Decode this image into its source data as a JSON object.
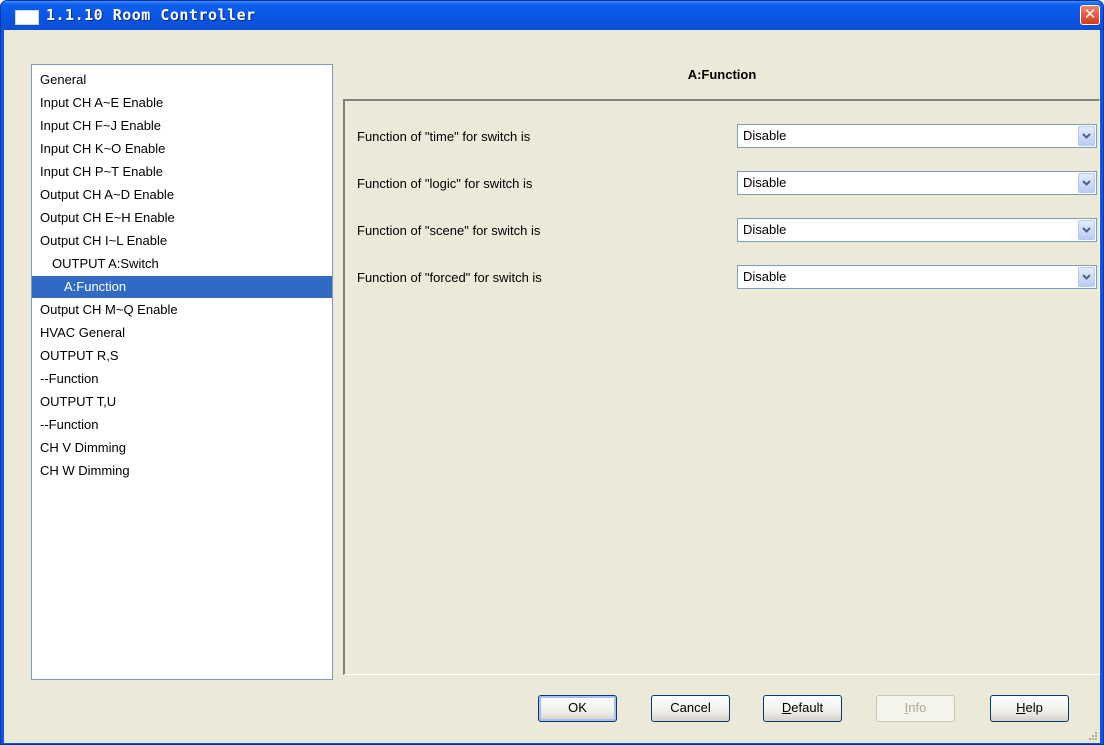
{
  "window": {
    "title": "1.1.10 Room Controller",
    "close_glyph": "✕"
  },
  "tree": {
    "items": [
      {
        "label": "General",
        "indent": 0,
        "selected": false
      },
      {
        "label": "Input CH A~E Enable",
        "indent": 0,
        "selected": false
      },
      {
        "label": "Input CH F~J Enable",
        "indent": 0,
        "selected": false
      },
      {
        "label": "Input CH K~O Enable",
        "indent": 0,
        "selected": false
      },
      {
        "label": "Input CH P~T Enable",
        "indent": 0,
        "selected": false
      },
      {
        "label": "Output CH A~D Enable",
        "indent": 0,
        "selected": false
      },
      {
        "label": "Output CH E~H Enable",
        "indent": 0,
        "selected": false
      },
      {
        "label": "Output CH I~L Enable",
        "indent": 0,
        "selected": false
      },
      {
        "label": "OUTPUT A:Switch",
        "indent": 1,
        "selected": false
      },
      {
        "label": "A:Function",
        "indent": 2,
        "selected": true
      },
      {
        "label": "Output CH M~Q Enable",
        "indent": 0,
        "selected": false
      },
      {
        "label": "HVAC General",
        "indent": 0,
        "selected": false
      },
      {
        "label": "OUTPUT R,S",
        "indent": 0,
        "selected": false
      },
      {
        "label": "--Function",
        "indent": 0,
        "selected": false
      },
      {
        "label": "OUTPUT T,U",
        "indent": 0,
        "selected": false
      },
      {
        "label": "--Function",
        "indent": 0,
        "selected": false
      },
      {
        "label": "CH V Dimming",
        "indent": 0,
        "selected": false
      },
      {
        "label": "CH W Dimming",
        "indent": 0,
        "selected": false
      }
    ]
  },
  "panel": {
    "title": "A:Function",
    "params": [
      {
        "label": "Function of \"time\" for switch is",
        "value": "Disable"
      },
      {
        "label": "Function of \"logic\" for switch is",
        "value": "Disable"
      },
      {
        "label": "Function of \"scene\" for switch is",
        "value": "Disable"
      },
      {
        "label": "Function of \"forced\" for switch is",
        "value": "Disable"
      }
    ]
  },
  "buttons": {
    "ok": "OK",
    "cancel": "Cancel",
    "default_first": "D",
    "default_rest": "efault",
    "info_first": "I",
    "info_rest": "nfo",
    "help_first": "H",
    "help_rest": "elp"
  },
  "colors": {
    "titlebar": "#0a55e3",
    "selection": "#316ac5",
    "face": "#ece9d8"
  },
  "icons": {
    "window": "window-icon",
    "close": "close-icon",
    "dropdown": "chevron-down-icon",
    "grip": "resize-grip-icon"
  }
}
